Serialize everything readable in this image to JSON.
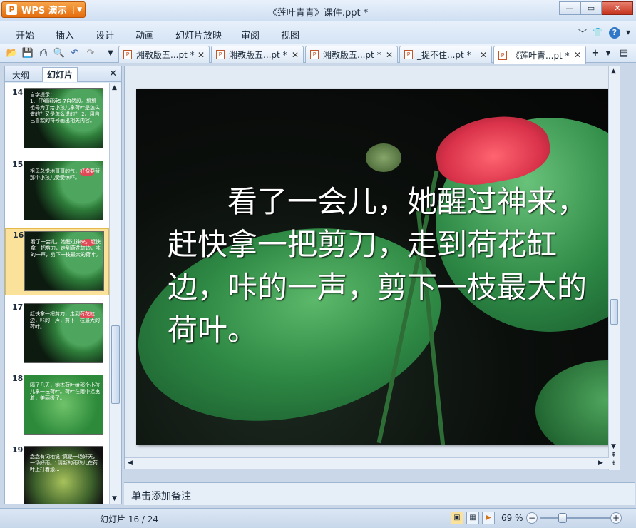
{
  "app": {
    "name": "WPS 演示",
    "window_title": "《莲叶青青》课件.ppt *"
  },
  "menu": [
    "开始",
    "插入",
    "设计",
    "动画",
    "幻灯片放映",
    "审阅",
    "视图"
  ],
  "tabs": [
    {
      "label": "湘教版五...pt *"
    },
    {
      "label": "湘教版五...pt *"
    },
    {
      "label": "湘教版五...pt *"
    },
    {
      "label": "_捉不住...pt *"
    },
    {
      "label": "《莲叶青...pt *",
      "active": true
    }
  ],
  "panel": {
    "tab_outline": "大纲",
    "tab_slides": "幻灯片"
  },
  "thumbnails": [
    {
      "num": "14",
      "text": "1、仔细阅读5-7自然段。想想祖母为了给小孩儿拿荷叶是怎么做的？又是怎么说的？ 2、用自己喜欢的符号画出相关内容。",
      "heading": "自学提示："
    },
    {
      "num": "15",
      "text": "祖母总觉地哥哥的气，好像要替那个小孩儿受受惊吓。"
    },
    {
      "num": "16",
      "text": "看了一会儿，她醒过神来，赶快拿一把剪刀，走到荷花缸边，咔的一声，剪下一枝最大的荷叶。",
      "selected": true
    },
    {
      "num": "17",
      "text": "赶快拿一把剪刀，走到荷花缸边，咔的一声，剪下一枝最大的荷叶。"
    },
    {
      "num": "18",
      "text": "隔了几天，她拣荷叶给那个小孩儿拿一枝荷叶。荷叶在雨中摇曳着，美丽极了。"
    },
    {
      "num": "19",
      "text": "念念有词地说 '真是一场好天，一场好雨。' 清新的雨珠儿在荷叶上打着滚..."
    }
  ],
  "slide": {
    "text": "看了一会儿，她醒过神来，赶快拿一把剪刀，走到荷花缸边，咔的一声，剪下一枝最大的荷叶。"
  },
  "notes_placeholder": "单击添加备注",
  "status": {
    "slide_counter": "幻灯片 16 / 24",
    "zoom": "69 %"
  }
}
